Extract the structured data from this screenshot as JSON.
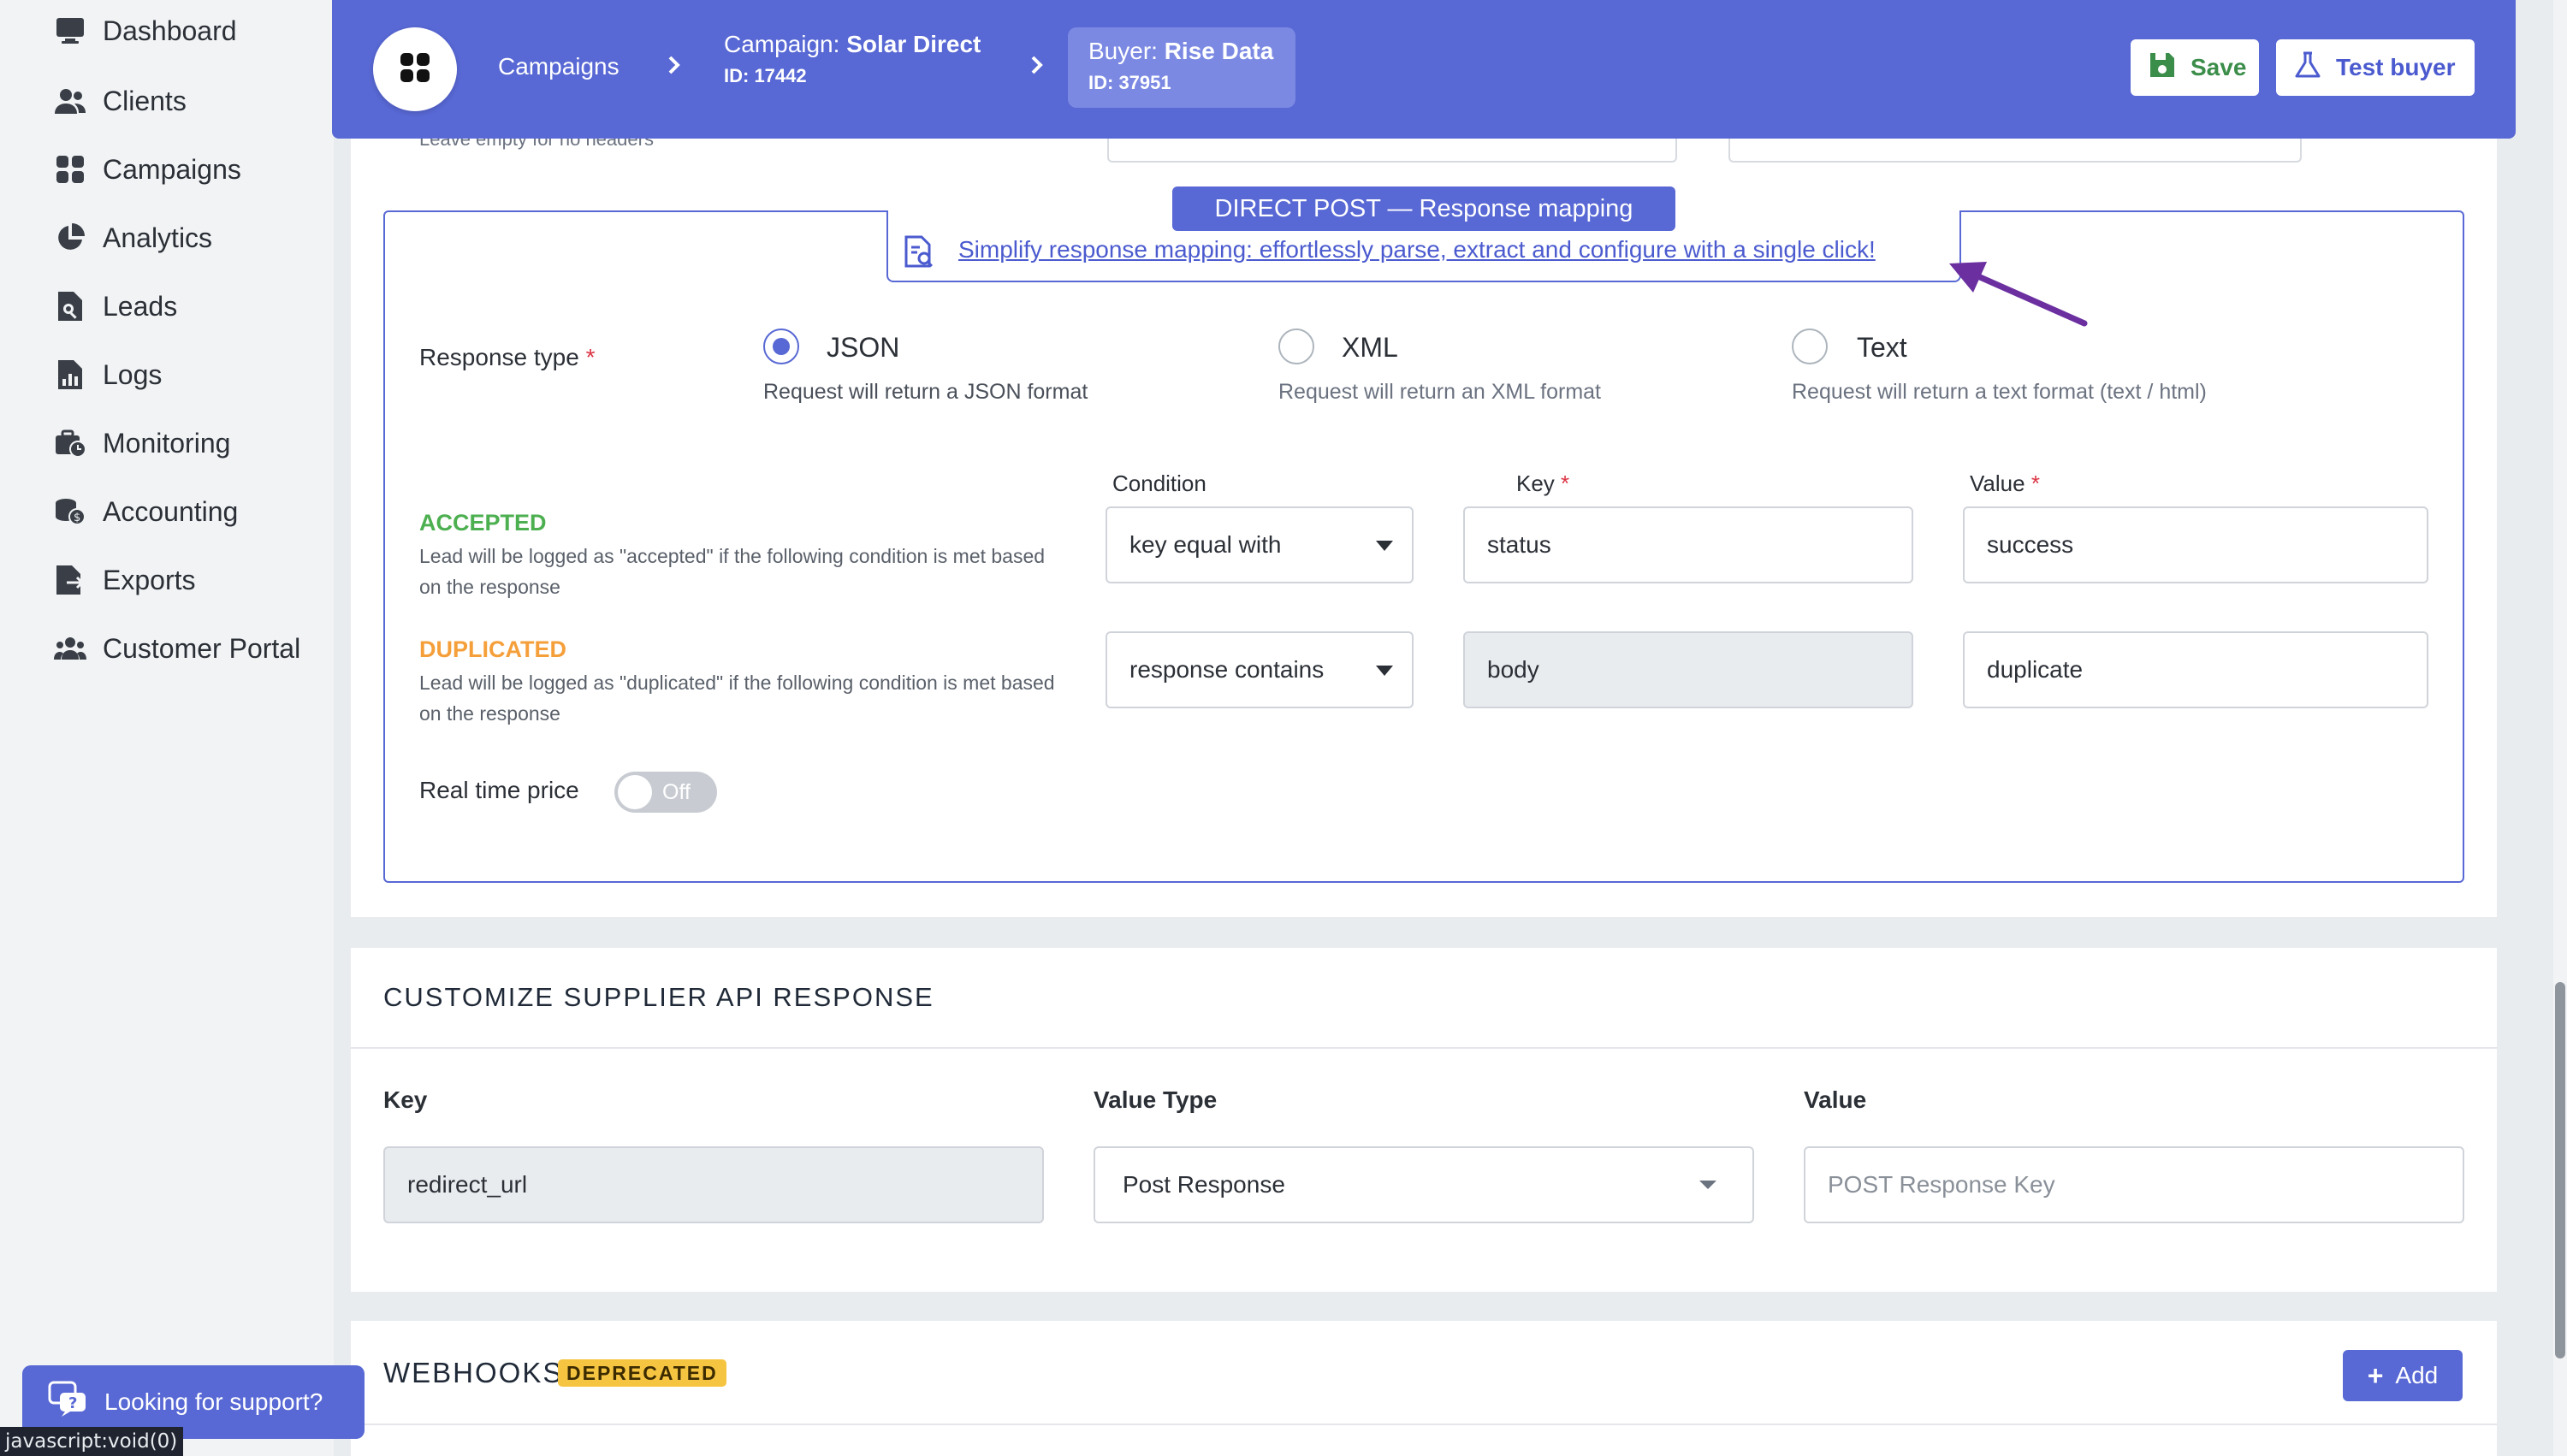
{
  "sidebar": {
    "items": [
      {
        "label": "Dashboard",
        "icon": "monitor-icon"
      },
      {
        "label": "Clients",
        "icon": "users-icon"
      },
      {
        "label": "Campaigns",
        "icon": "grid-icon"
      },
      {
        "label": "Analytics",
        "icon": "pie-chart-icon"
      },
      {
        "label": "Leads",
        "icon": "file-search-icon"
      },
      {
        "label": "Logs",
        "icon": "file-chart-icon"
      },
      {
        "label": "Monitoring",
        "icon": "briefcase-clock-icon"
      },
      {
        "label": "Accounting",
        "icon": "coins-icon"
      },
      {
        "label": "Exports",
        "icon": "file-export-icon"
      },
      {
        "label": "Customer Portal",
        "icon": "people-group-icon"
      }
    ]
  },
  "topbar": {
    "crumb_campaigns": "Campaigns",
    "campaign_prefix": "Campaign: ",
    "campaign_name": "Solar Direct",
    "campaign_id": "ID: 17442",
    "buyer_prefix": "Buyer: ",
    "buyer_name": "Rise Data",
    "buyer_id": "ID: 37951",
    "save_label": "Save",
    "test_label": "Test buyer"
  },
  "headers_hint": "Leave empty for no headers",
  "mapping": {
    "section_title": "DIRECT POST — Response mapping",
    "simplify_link": "Simplify response mapping: effortlessly parse, extract and configure with a single click!",
    "response_type_label": "Response type",
    "required_mark": "*",
    "options": [
      {
        "label": "JSON",
        "desc": "Request will return a JSON format",
        "checked": true
      },
      {
        "label": "XML",
        "desc": "Request will return an XML format",
        "checked": false
      },
      {
        "label": "Text",
        "desc": "Request will return a text format (text / html)",
        "checked": false
      }
    ],
    "col_condition": "Condition",
    "col_key": "Key",
    "col_value": "Value",
    "accepted": {
      "title": "ACCEPTED",
      "desc": "Lead will be logged as \"accepted\" if the following condition is met based on the response",
      "condition": "key equal with",
      "key": "status",
      "value": "success",
      "color": "#4caf50"
    },
    "duplicated": {
      "title": "DUPLICATED",
      "desc": "Lead will be logged as \"duplicated\" if the following condition is met based on the response",
      "condition": "response contains",
      "key": "body",
      "value": "duplicate",
      "color": "#f59f3a"
    },
    "real_time_label": "Real time price",
    "real_time_state": "Off"
  },
  "customize": {
    "title": "CUSTOMIZE SUPPLIER API RESPONSE",
    "col_key": "Key",
    "col_value_type": "Value Type",
    "col_value": "Value",
    "key_value": "redirect_url",
    "value_type": "Post Response",
    "value_placeholder": "POST Response Key"
  },
  "webhooks": {
    "title": "WEBHOOKS",
    "badge": "DEPRECATED",
    "add_label": "Add"
  },
  "support_label": "Looking for support?",
  "statusbar_text": "javascript:void(0)",
  "colors": {
    "accent": "#5868d4",
    "accepted": "#4caf50",
    "duplicated": "#f59f3a",
    "arrow": "#6b2fa0"
  }
}
